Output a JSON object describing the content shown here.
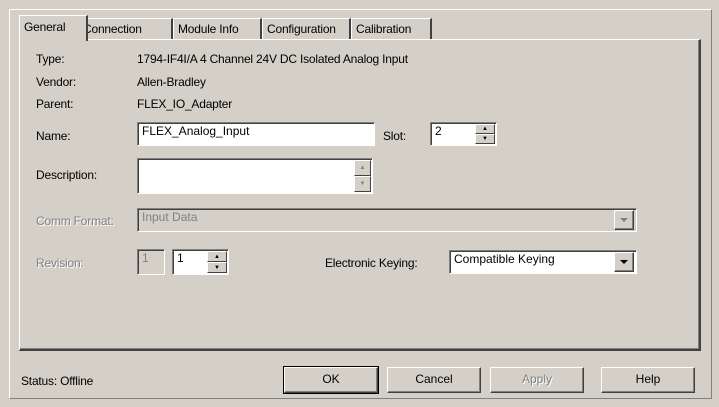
{
  "tabs": [
    {
      "label": "General",
      "active": true
    },
    {
      "label": "Connection",
      "active": false
    },
    {
      "label": "Module Info",
      "active": false
    },
    {
      "label": "Configuration",
      "active": false
    },
    {
      "label": "Calibration",
      "active": false
    }
  ],
  "general": {
    "type_label": "Type:",
    "type_value": "1794-IF4I/A 4 Channel 24V DC Isolated Analog Input",
    "vendor_label": "Vendor:",
    "vendor_value": "Allen-Bradley",
    "parent_label": "Parent:",
    "parent_value": "FLEX_IO_Adapter",
    "name_label": "Name:",
    "name_value": "FLEX_Analog_Input",
    "slot_label": "Slot:",
    "slot_value": "2",
    "description_label": "Description:",
    "description_value": "",
    "comm_format_label": "Comm Format:",
    "comm_format_value": "Input Data",
    "revision_label": "Revision:",
    "revision_major": "1",
    "revision_minor": "1",
    "keying_label": "Electronic Keying:",
    "keying_value": "Compatible Keying"
  },
  "footer": {
    "status": "Status:  Offline",
    "ok": "OK",
    "cancel": "Cancel",
    "apply": "Apply",
    "help": "Help"
  }
}
